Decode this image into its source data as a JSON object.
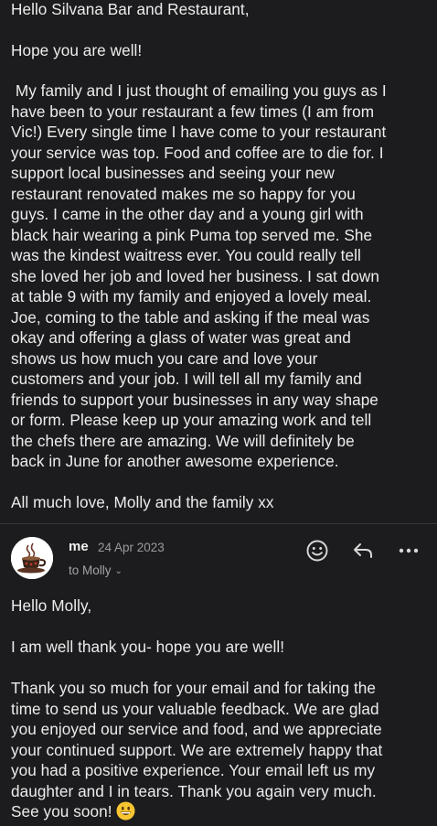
{
  "first_email": {
    "greeting": "Hello Silvana Bar and Restaurant,",
    "opening": "Hope you are well!",
    "body_lines": [
      " My family and I just thought of emailing you guys as I",
      "have been to your restaurant a few times (I am from",
      "Vic!) Every single time I have come to your restaurant",
      "your service was top. Food and coffee are to die for. I",
      "support local businesses and seeing your new",
      "restaurant renovated makes me so happy for you",
      "guys. I came in the other day and a young girl with",
      "black hair wearing a pink Puma top served me. She",
      "was the kindest waitress ever. You could really tell",
      "she loved her job and loved her business. I sat down",
      "at table 9 with my family and enjoyed a lovely meal.",
      "Joe, coming to the table and asking if the meal was",
      "okay and offering a glass of water was great and",
      "shows us how much you care and love your",
      "customers and your job. I will tell all my family and",
      "friends to support your businesses in any way shape",
      "or form. Please keep up your amazing work and tell",
      "the chefs there are amazing. We will definitely be",
      "back in June for another awesome experience."
    ],
    "signoff": "All much love, Molly and the family xx"
  },
  "reply": {
    "sender": "me",
    "date": "24 Apr 2023",
    "recipient": "to Molly",
    "avatar_icon": "coffee-cup-logo",
    "greeting": "Hello Molly,",
    "line1": "I am well thank you- hope you are well!",
    "body_lines": [
      "Thank you so much for your email and for taking the",
      "time to send us your valuable feedback. We are glad",
      "you enjoyed our service and food, and we appreciate",
      "your continued support. We are extremely happy that",
      "you had a positive experience. Your email left us my",
      "daughter and I in tears. Thank you again very much.",
      "See you soon!"
    ],
    "emoji": "grinning-face-emoji"
  },
  "actions": {
    "react_icon": "smiley-react-icon",
    "reply_icon": "reply-arrow-icon",
    "more_icon": "more-horizontal-icon"
  },
  "colors": {
    "background": "#1c1c1e",
    "text": "#ececec",
    "muted": "#9a9a9e"
  }
}
